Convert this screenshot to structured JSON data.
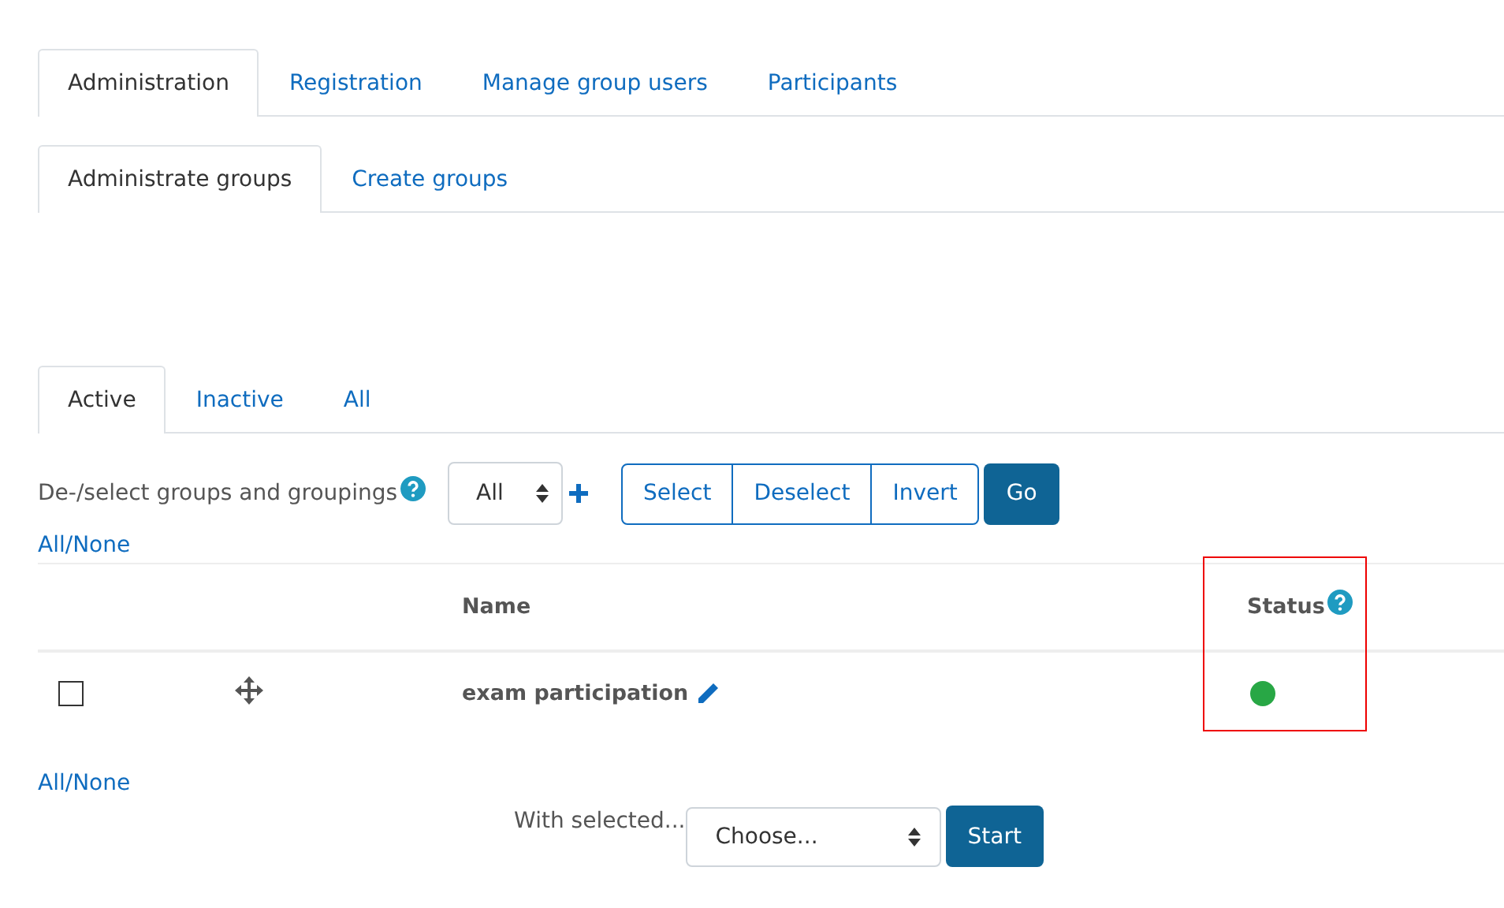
{
  "main_tabs": [
    {
      "label": "Administration",
      "selected": true
    },
    {
      "label": "Registration",
      "selected": false
    },
    {
      "label": "Manage group users",
      "selected": false
    },
    {
      "label": "Participants",
      "selected": false
    }
  ],
  "sub_tabs": [
    {
      "label": "Administrate groups",
      "selected": true
    },
    {
      "label": "Create groups",
      "selected": false
    }
  ],
  "filter_tabs": [
    {
      "label": "Active",
      "selected": true
    },
    {
      "label": "Inactive",
      "selected": false
    },
    {
      "label": "All",
      "selected": false
    }
  ],
  "selector": {
    "label": "De-/select groups and groupings",
    "dropdown": "All",
    "buttons": [
      "Select",
      "Deselect",
      "Invert"
    ],
    "go": "Go"
  },
  "all_none_top": "All/None",
  "table": {
    "columns": [
      {
        "label": "Name",
        "help": false,
        "highlighted": false
      },
      {
        "label": "Status",
        "help": true,
        "highlighted": true
      }
    ],
    "rows": [
      {
        "checked": false,
        "name": "exam participation",
        "color": "#28a745"
      }
    ]
  },
  "all_none_bottom": "All/None",
  "bulk": {
    "label": "With selected...",
    "dropdown": "Choose...",
    "button": "Start"
  }
}
